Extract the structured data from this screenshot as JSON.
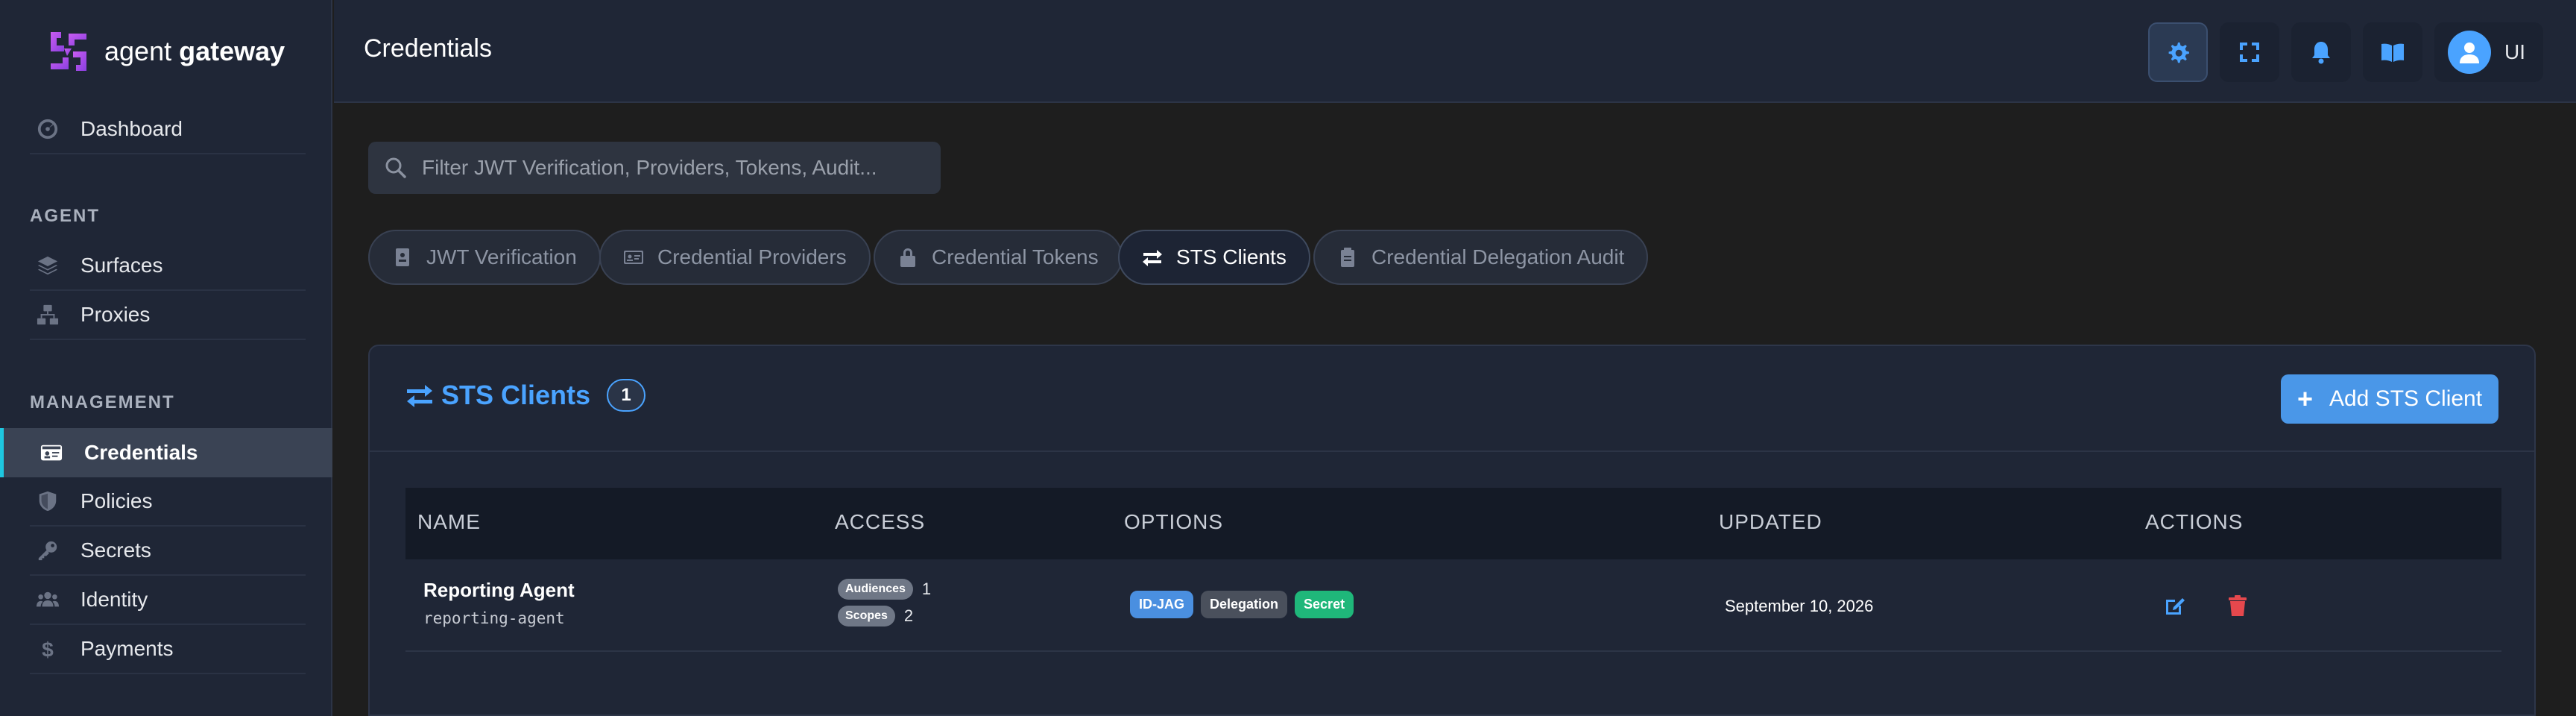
{
  "app": {
    "brand_light": "agent",
    "brand_bold": "gateway",
    "accent": "#4aa3ff",
    "active_indicator": "#1ec7e0"
  },
  "sidebar": {
    "dashboard": "Dashboard",
    "sections": {
      "agent": "AGENT",
      "management": "MANAGEMENT"
    },
    "agent_items": [
      "Surfaces",
      "Proxies"
    ],
    "management_items": [
      "Credentials",
      "Policies",
      "Secrets",
      "Identity",
      "Payments"
    ],
    "active_item": "Credentials"
  },
  "header": {
    "title": "Credentials",
    "user_initials": "UI",
    "icons": [
      "gear-icon",
      "fullscreen-icon",
      "bell-icon",
      "book-icon",
      "user-icon"
    ]
  },
  "search": {
    "placeholder": "Filter JWT Verification, Providers, Tokens, Audit..."
  },
  "tabs": [
    {
      "label": "JWT Verification",
      "icon": "id-badge-icon"
    },
    {
      "label": "Credential Providers",
      "icon": "id-card-icon"
    },
    {
      "label": "Credential Tokens",
      "icon": "lock-icon"
    },
    {
      "label": "STS Clients",
      "icon": "swap-arrows-icon",
      "active": true
    },
    {
      "label": "Credential Delegation Audit",
      "icon": "clipboard-icon"
    }
  ],
  "card": {
    "title": "STS Clients",
    "count": "1",
    "add_button": "Add STS Client"
  },
  "table": {
    "headers": [
      "NAME",
      "ACCESS",
      "OPTIONS",
      "UPDATED",
      "ACTIONS"
    ],
    "rows": [
      {
        "name": "Reporting Agent",
        "id": "reporting-agent",
        "audiences_label": "Audiences",
        "audiences_count": "1",
        "scopes_label": "Scopes",
        "scopes_count": "2",
        "options": [
          "ID-JAG",
          "Delegation",
          "Secret"
        ],
        "updated": "September 10, 2026"
      }
    ]
  }
}
